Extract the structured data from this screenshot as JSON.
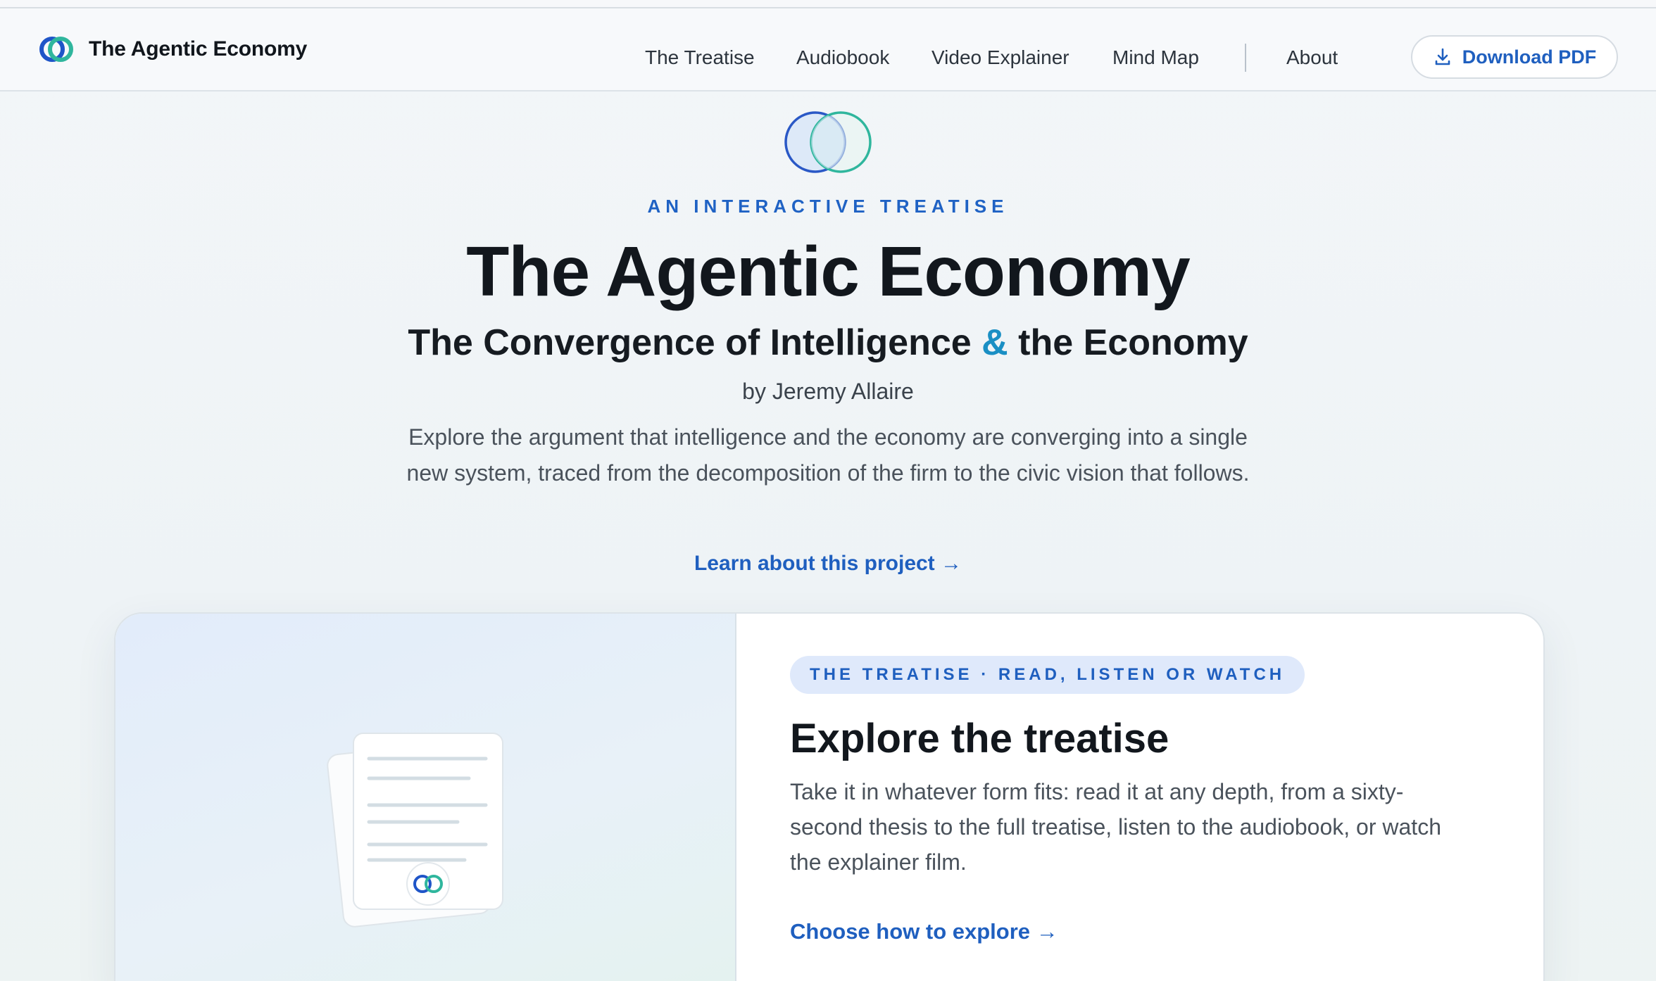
{
  "header": {
    "brand_title": "The Agentic Economy",
    "nav": [
      {
        "label": "The Treatise"
      },
      {
        "label": "Audiobook"
      },
      {
        "label": "Video Explainer"
      },
      {
        "label": "Mind Map"
      },
      {
        "label": "About"
      }
    ],
    "download_label": "Download PDF",
    "download_icon": "download-icon",
    "logo_icon": "interlocking-rings-logo"
  },
  "hero": {
    "eyebrow": "AN INTERACTIVE TREATISE",
    "title": "The Agentic Economy",
    "subtitle_part1": "The Convergence of Intelligence ",
    "subtitle_amp": "&",
    "subtitle_part2": " the Economy",
    "byline": "by Jeremy Allaire",
    "description": "Explore the argument that intelligence and the economy are converging into a single new system, traced from the decomposition of the firm to the civic vision that follows.",
    "learn_link": "Learn about this project →"
  },
  "card": {
    "pill": "THE TREATISE · READ, LISTEN OR WATCH",
    "title": "Explore the treatise",
    "description": "Take it in whatever form fits: read it at any depth, from a sixty-second thesis to the full treatise, listen to the audiobook, or watch the explainer film.",
    "link": "Choose how to explore →",
    "art_icon": "document-stack-icon"
  },
  "colors": {
    "accent_blue": "#1f5fbf",
    "accent_teal": "#2db39b",
    "ampersand": "#1a8fc4",
    "text_dark": "#12171d"
  }
}
